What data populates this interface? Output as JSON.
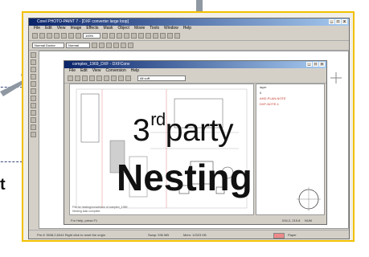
{
  "background_fragments": {
    "left_bullet": "t"
  },
  "app": {
    "title": "Corel PHOTO-PAINT 7 - [DXF converter large loop]",
    "menu": [
      "File",
      "Edit",
      "View",
      "Image",
      "Effects",
      "Mask",
      "Object",
      "Movie",
      "Tools",
      "Window",
      "Help"
    ],
    "toolbar_select_1": "Normal Doctor",
    "toolbar_select_2": "Normal",
    "toolbar_select_3": "100%",
    "status_left": "Pre-K 3538,2,6044   Right click to reset the origin",
    "status_mid": "Swap: 936 MB",
    "status_mem": "Mem: 12323 KB",
    "status_right": "Paper"
  },
  "doc": {
    "title": "complex_1969_DXF - DXFConv",
    "menu": [
      "File",
      "Edit",
      "View",
      "Conversion",
      "Help"
    ],
    "combo": "All cuff",
    "layers": [
      {
        "label": "layer",
        "color": "normal"
      },
      {
        "label": "0",
        "color": "normal"
      },
      {
        "label": "AHD-PLAN-NOTE",
        "color": "red"
      },
      {
        "label": "DXF-NOTE-1",
        "color": "red"
      }
    ],
    "console_line_1": "File for nesting/conversion of complex_1969",
    "console_line_2": "Nesting task complete",
    "status_left": "For Help, press F1",
    "status_right_1": "X34.2, 215.8",
    "status_right_2": "NUM"
  },
  "overlay": {
    "line1_prefix": "3",
    "line1_sup": "rd",
    "line1_suffix": "party",
    "line2": "Nesting"
  }
}
